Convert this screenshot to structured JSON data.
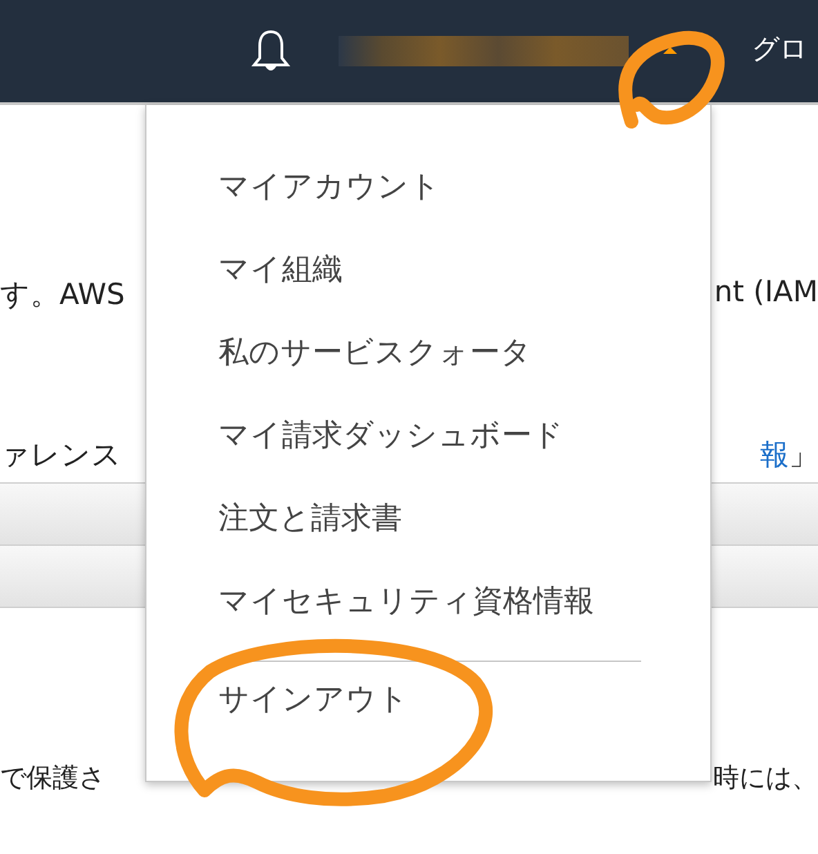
{
  "navbar": {
    "region_label": "グロ"
  },
  "page": {
    "line_1": {
      "left": "す。AWS",
      "right": "nt (IAM"
    },
    "line_2": {
      "left": "ァレンス",
      "link": "報",
      "right": " 」"
    },
    "line_3": {
      "left": "で保護さ",
      "right": "時には、"
    }
  },
  "account_menu": {
    "expanded": true,
    "items": [
      {
        "label": "マイアカウント"
      },
      {
        "label": "マイ組織"
      },
      {
        "label": "私のサービスクォータ"
      },
      {
        "label": "マイ請求ダッシュボード"
      },
      {
        "label": "注文と請求書"
      },
      {
        "label": "マイセキュリティ資格情報"
      }
    ],
    "sign_out": "サインアウト"
  }
}
